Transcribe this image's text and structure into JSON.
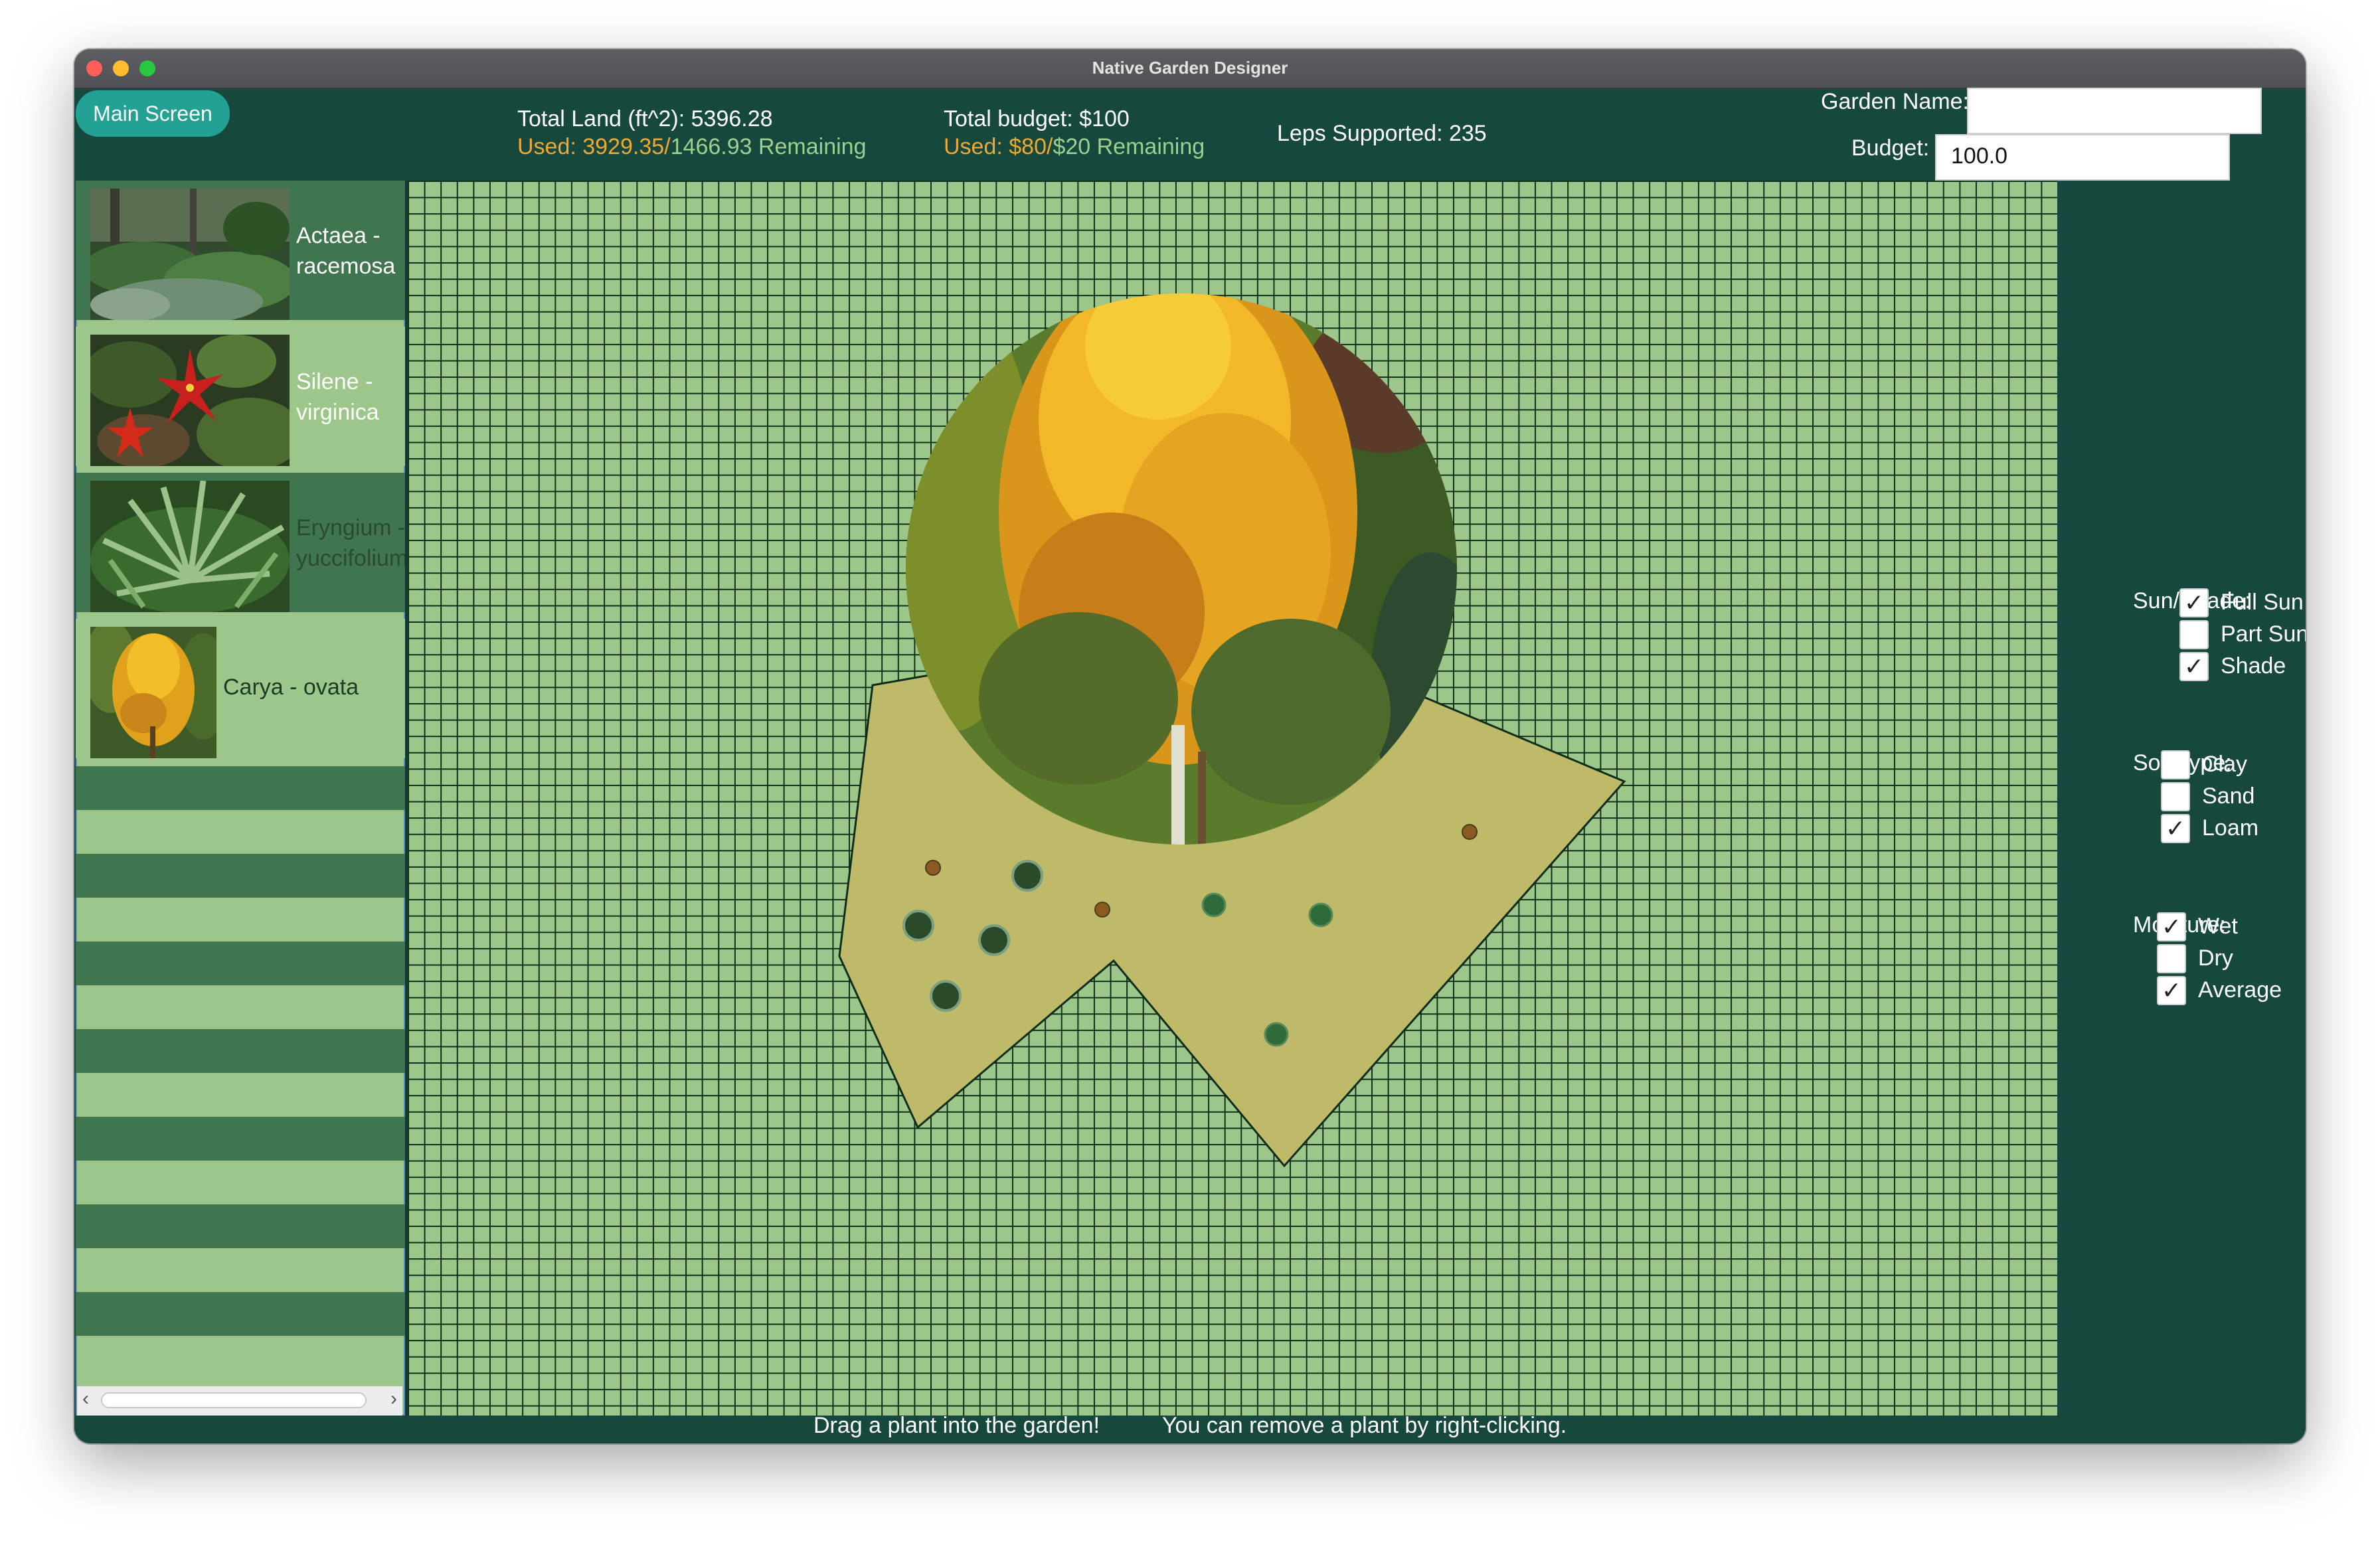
{
  "window": {
    "title": "Native Garden Designer"
  },
  "nav": {
    "main_screen": "Main Screen"
  },
  "land": {
    "total_label": "Total Land (ft^2): 5396.28",
    "used_label": "Used: 3929.35/",
    "remaining_label": "1466.93 Remaining"
  },
  "budget_stats": {
    "total_label": "Total budget: $100",
    "used_label": "Used: $80/",
    "remaining_label": "$20 Remaining"
  },
  "leps": {
    "label": "Leps Supported: 235"
  },
  "form": {
    "garden_name_label": "Garden Name:",
    "garden_name_value": "",
    "budget_label": "Budget:",
    "budget_value": "100.0"
  },
  "plants": [
    {
      "genus": "Actaea -",
      "species": "racemosa"
    },
    {
      "genus": "Silene -",
      "species": "virginica"
    },
    {
      "genus": "Eryngium -",
      "species": "yuccifolium"
    },
    {
      "genus": "Carya - ovata",
      "species": ""
    }
  ],
  "filters": {
    "sun_label": "Sun/Shade:",
    "sun": [
      {
        "label": "Full Sun",
        "checked": true,
        "mark": "✓"
      },
      {
        "label": "Part Sun",
        "checked": false,
        "mark": ""
      },
      {
        "label": "Shade",
        "checked": true,
        "mark": "✓"
      }
    ],
    "soil_label": "Soil Type:",
    "soil": [
      {
        "label": "Clay",
        "checked": false,
        "mark": ""
      },
      {
        "label": "Sand",
        "checked": false,
        "mark": ""
      },
      {
        "label": "Loam",
        "checked": true,
        "mark": "✓"
      }
    ],
    "moisture_label": "Moisture:",
    "moisture": [
      {
        "label": "Wet",
        "checked": true,
        "mark": "✓"
      },
      {
        "label": "Dry",
        "checked": false,
        "mark": ""
      },
      {
        "label": "Average",
        "checked": true,
        "mark": "✓"
      }
    ]
  },
  "status": {
    "drag_hint": "Drag a plant into the garden!",
    "remove_hint": "You can remove a plant by right-clicking."
  },
  "colors": {
    "panel_bg": "#16483e",
    "grid_bg": "#9dc78a",
    "garden_plot": "#bfba6a",
    "accent_button": "#23a194",
    "used_text": "#f0a830",
    "remaining_text": "#9dd08e"
  }
}
